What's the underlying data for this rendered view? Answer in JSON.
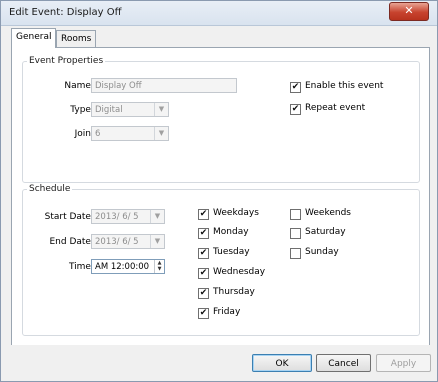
{
  "window": {
    "title": "Edit Event: Display Off",
    "close_label": "✕"
  },
  "tabs": [
    {
      "label": "General"
    },
    {
      "label": "Rooms"
    }
  ],
  "event_properties": {
    "legend": "Event Properties",
    "name": {
      "label": "Name:",
      "value": "Display Off"
    },
    "type": {
      "label": "Type:",
      "value": "Digital"
    },
    "join": {
      "label": "Join:",
      "value": "6"
    },
    "enable": {
      "label": "Enable this event",
      "checked": true
    },
    "repeat": {
      "label": "Repeat event",
      "checked": true
    }
  },
  "schedule": {
    "legend": "Schedule",
    "start_date": {
      "label": "Start Date:",
      "value": "2013/ 6/ 5"
    },
    "end_date": {
      "label": "End Date:",
      "value": "2013/ 6/ 5"
    },
    "time": {
      "label": "Time:",
      "value": "AM 12:00:00"
    },
    "days_left": [
      {
        "label": "Weekdays",
        "checked": true
      },
      {
        "label": "Monday",
        "checked": true
      },
      {
        "label": "Tuesday",
        "checked": true
      },
      {
        "label": "Wednesday",
        "checked": true
      },
      {
        "label": "Thursday",
        "checked": true
      },
      {
        "label": "Friday",
        "checked": true
      }
    ],
    "days_right": [
      {
        "label": "Weekends",
        "checked": false
      },
      {
        "label": "Saturday",
        "checked": false
      },
      {
        "label": "Sunday",
        "checked": false
      }
    ]
  },
  "buttons": {
    "ok": "OK",
    "cancel": "Cancel",
    "apply": "Apply"
  },
  "glyphs": {
    "check": "✔",
    "dropdown": "▼",
    "spin_up": "▲",
    "spin_down": "▼"
  }
}
